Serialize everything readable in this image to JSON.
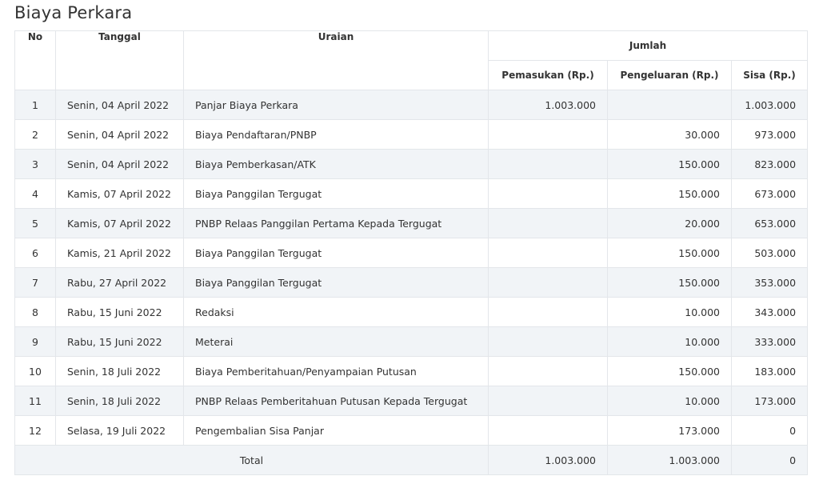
{
  "title": "Biaya Perkara",
  "headers": {
    "no": "No",
    "tanggal": "Tanggal",
    "uraian": "Uraian",
    "jumlah": "Jumlah",
    "pemasukan": "Pemasukan (Rp.)",
    "pengeluaran": "Pengeluaran (Rp.)",
    "sisa": "Sisa (Rp.)"
  },
  "rows": [
    {
      "no": "1",
      "tanggal": "Senin, 04 April 2022",
      "uraian": "Panjar Biaya Perkara",
      "pemasukan": "1.003.000",
      "pengeluaran": "",
      "sisa": "1.003.000"
    },
    {
      "no": "2",
      "tanggal": "Senin, 04 April 2022",
      "uraian": "Biaya Pendaftaran/PNBP",
      "pemasukan": "",
      "pengeluaran": "30.000",
      "sisa": "973.000"
    },
    {
      "no": "3",
      "tanggal": "Senin, 04 April 2022",
      "uraian": "Biaya Pemberkasan/ATK",
      "pemasukan": "",
      "pengeluaran": "150.000",
      "sisa": "823.000"
    },
    {
      "no": "4",
      "tanggal": "Kamis, 07 April 2022",
      "uraian": "Biaya Panggilan Tergugat",
      "pemasukan": "",
      "pengeluaran": "150.000",
      "sisa": "673.000"
    },
    {
      "no": "5",
      "tanggal": "Kamis, 07 April 2022",
      "uraian": "PNBP Relaas Panggilan Pertama Kepada Tergugat",
      "pemasukan": "",
      "pengeluaran": "20.000",
      "sisa": "653.000"
    },
    {
      "no": "6",
      "tanggal": "Kamis, 21 April 2022",
      "uraian": "Biaya Panggilan Tergugat",
      "pemasukan": "",
      "pengeluaran": "150.000",
      "sisa": "503.000"
    },
    {
      "no": "7",
      "tanggal": "Rabu, 27 April 2022",
      "uraian": "Biaya Panggilan Tergugat",
      "pemasukan": "",
      "pengeluaran": "150.000",
      "sisa": "353.000"
    },
    {
      "no": "8",
      "tanggal": "Rabu, 15 Juni 2022",
      "uraian": "Redaksi",
      "pemasukan": "",
      "pengeluaran": "10.000",
      "sisa": "343.000"
    },
    {
      "no": "9",
      "tanggal": "Rabu, 15 Juni 2022",
      "uraian": "Meterai",
      "pemasukan": "",
      "pengeluaran": "10.000",
      "sisa": "333.000"
    },
    {
      "no": "10",
      "tanggal": "Senin, 18 Juli 2022",
      "uraian": "Biaya Pemberitahuan/Penyampaian Putusan",
      "pemasukan": "",
      "pengeluaran": "150.000",
      "sisa": "183.000"
    },
    {
      "no": "11",
      "tanggal": "Senin, 18 Juli 2022",
      "uraian": "PNBP Relaas Pemberitahuan Putusan Kepada Tergugat",
      "pemasukan": "",
      "pengeluaran": "10.000",
      "sisa": "173.000"
    },
    {
      "no": "12",
      "tanggal": "Selasa, 19 Juli 2022",
      "uraian": "Pengembalian Sisa Panjar",
      "pemasukan": "",
      "pengeluaran": "173.000",
      "sisa": "0"
    }
  ],
  "total": {
    "label": "Total",
    "pemasukan": "1.003.000",
    "pengeluaran": "1.003.000",
    "sisa": "0"
  }
}
